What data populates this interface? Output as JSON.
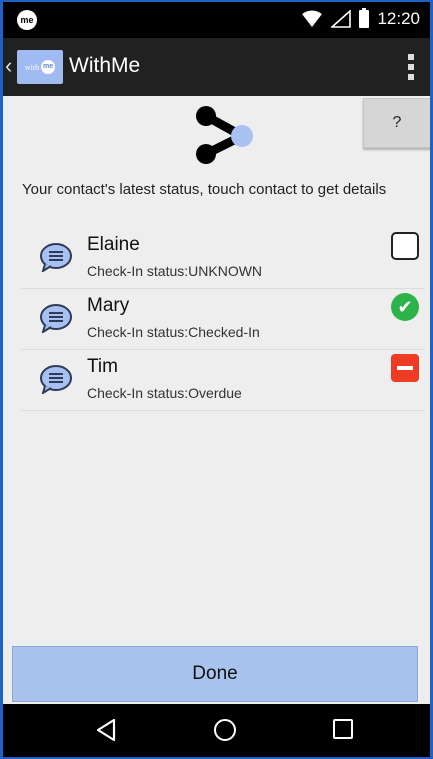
{
  "status_bar": {
    "app_badge": "me",
    "time": "12:20",
    "icons": [
      "wifi-icon",
      "signal-icon",
      "battery-icon"
    ]
  },
  "app_bar": {
    "title": "WithMe",
    "logo_text_with": "with",
    "logo_text_me": "me",
    "icons": [
      "back-chevron-icon",
      "overflow-menu-icon"
    ]
  },
  "header": {
    "share_icon": "share-icon",
    "help_label": "?"
  },
  "instructions": "Your contact's latest status, touch contact to get details",
  "contacts": [
    {
      "name": "Elaine",
      "status": "Check-In status:UNKNOWN",
      "state": "unknown",
      "icon": "empty-box-icon"
    },
    {
      "name": "Mary",
      "status": "Check-In status:Checked-In",
      "state": "checked-in",
      "icon": "green-check-icon"
    },
    {
      "name": "Tim",
      "status": "Check-In status:Overdue",
      "state": "overdue",
      "icon": "red-minus-icon"
    }
  ],
  "done_label": "Done",
  "nav": {
    "icons": [
      "nav-back-icon",
      "nav-home-icon",
      "nav-recents-icon"
    ]
  },
  "colors": {
    "accent": "#a9c3ef",
    "checked_in": "#2db34a",
    "overdue": "#ee3b23",
    "app_bar": "#212121"
  }
}
